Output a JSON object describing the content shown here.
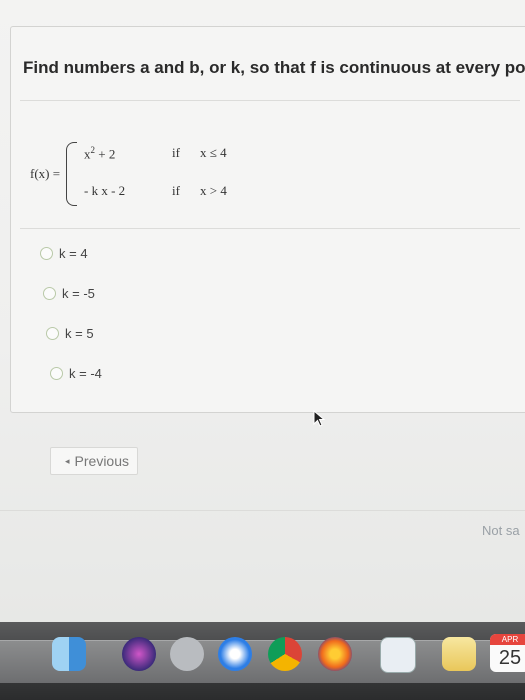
{
  "question": "Find numbers a and b, or k, so that f is continuous at every point",
  "function": {
    "name": "f(x) =",
    "case1": {
      "expr_base": "x",
      "expr_exp": "2",
      "expr_tail": " + 2",
      "if": "if",
      "cond": "x ≤ 4"
    },
    "case2": {
      "expr": "- k x  -  2",
      "if": "if",
      "cond": "x > 4"
    }
  },
  "options": [
    {
      "label": "k = 4"
    },
    {
      "label": "k = -5"
    },
    {
      "label": "k = 5"
    },
    {
      "label": "k = -4"
    }
  ],
  "nav": {
    "previous_label": "Previous"
  },
  "status": "Not sa",
  "dock": {
    "calendar_month": "APR",
    "calendar_day": "25",
    "icons": [
      "finder-icon",
      "siri-icon",
      "launchpad-icon",
      "safari-icon",
      "chrome-icon",
      "firefox-icon",
      "preview-icon",
      "notes-icon",
      "calendar-icon"
    ]
  },
  "colors": {
    "radio_border": "#b9c9a8",
    "text": "#2a2a2a",
    "dock": "#3b3c3d"
  }
}
